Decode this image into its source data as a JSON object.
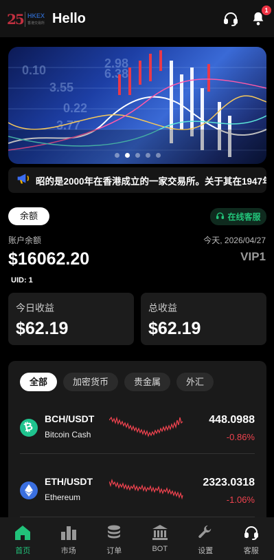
{
  "header": {
    "title": "Hello",
    "logo_text": "HKEX",
    "logo_sub": "香港交易所",
    "notification_count": "1"
  },
  "banner": {
    "slide_count": 5,
    "active_slide": 1
  },
  "notice": {
    "text": "昭的是2000年在香港成立的一家交易所。关于其在1947年"
  },
  "account": {
    "balance_button": "余额",
    "service_button": "在线客服",
    "account_label": "账户余额",
    "date": "今天, 2026/04/27",
    "balance": "$16062.20",
    "vip": "VIP1",
    "uid": "UID: 1"
  },
  "cards": [
    {
      "label": "今日收益",
      "value": "$62.19"
    },
    {
      "label": "总收益",
      "value": "$62.19"
    }
  ],
  "market": {
    "tabs": [
      "全部",
      "加密货币",
      "贵金属",
      "外汇"
    ],
    "active_tab": 0,
    "rows": [
      {
        "pair": "BCH/USDT",
        "name": "Bitcoin Cash",
        "price": "448.0988",
        "change": "-0.86%",
        "icon": "bitcoin-cash-icon",
        "icon_color": "#1fc38e"
      },
      {
        "pair": "ETH/USDT",
        "name": "Ethereum",
        "price": "2323.0318",
        "change": "-1.06%",
        "icon": "ethereum-icon",
        "icon_color": "#3a6fe0"
      }
    ]
  },
  "nav": [
    {
      "label": "首页",
      "icon": "home-icon",
      "active": true
    },
    {
      "label": "市场",
      "icon": "chart-icon",
      "active": false
    },
    {
      "label": "订单",
      "icon": "coins-stack-icon",
      "active": false
    },
    {
      "label": "BOT",
      "icon": "bank-icon",
      "active": false
    },
    {
      "label": "设置",
      "icon": "wrench-icon",
      "active": false
    },
    {
      "label": "客服",
      "icon": "headset-icon",
      "active": false
    }
  ],
  "colors": {
    "accent_green": "#21c27a",
    "negative_red": "#f0434f",
    "badge_red": "#ee3344"
  }
}
